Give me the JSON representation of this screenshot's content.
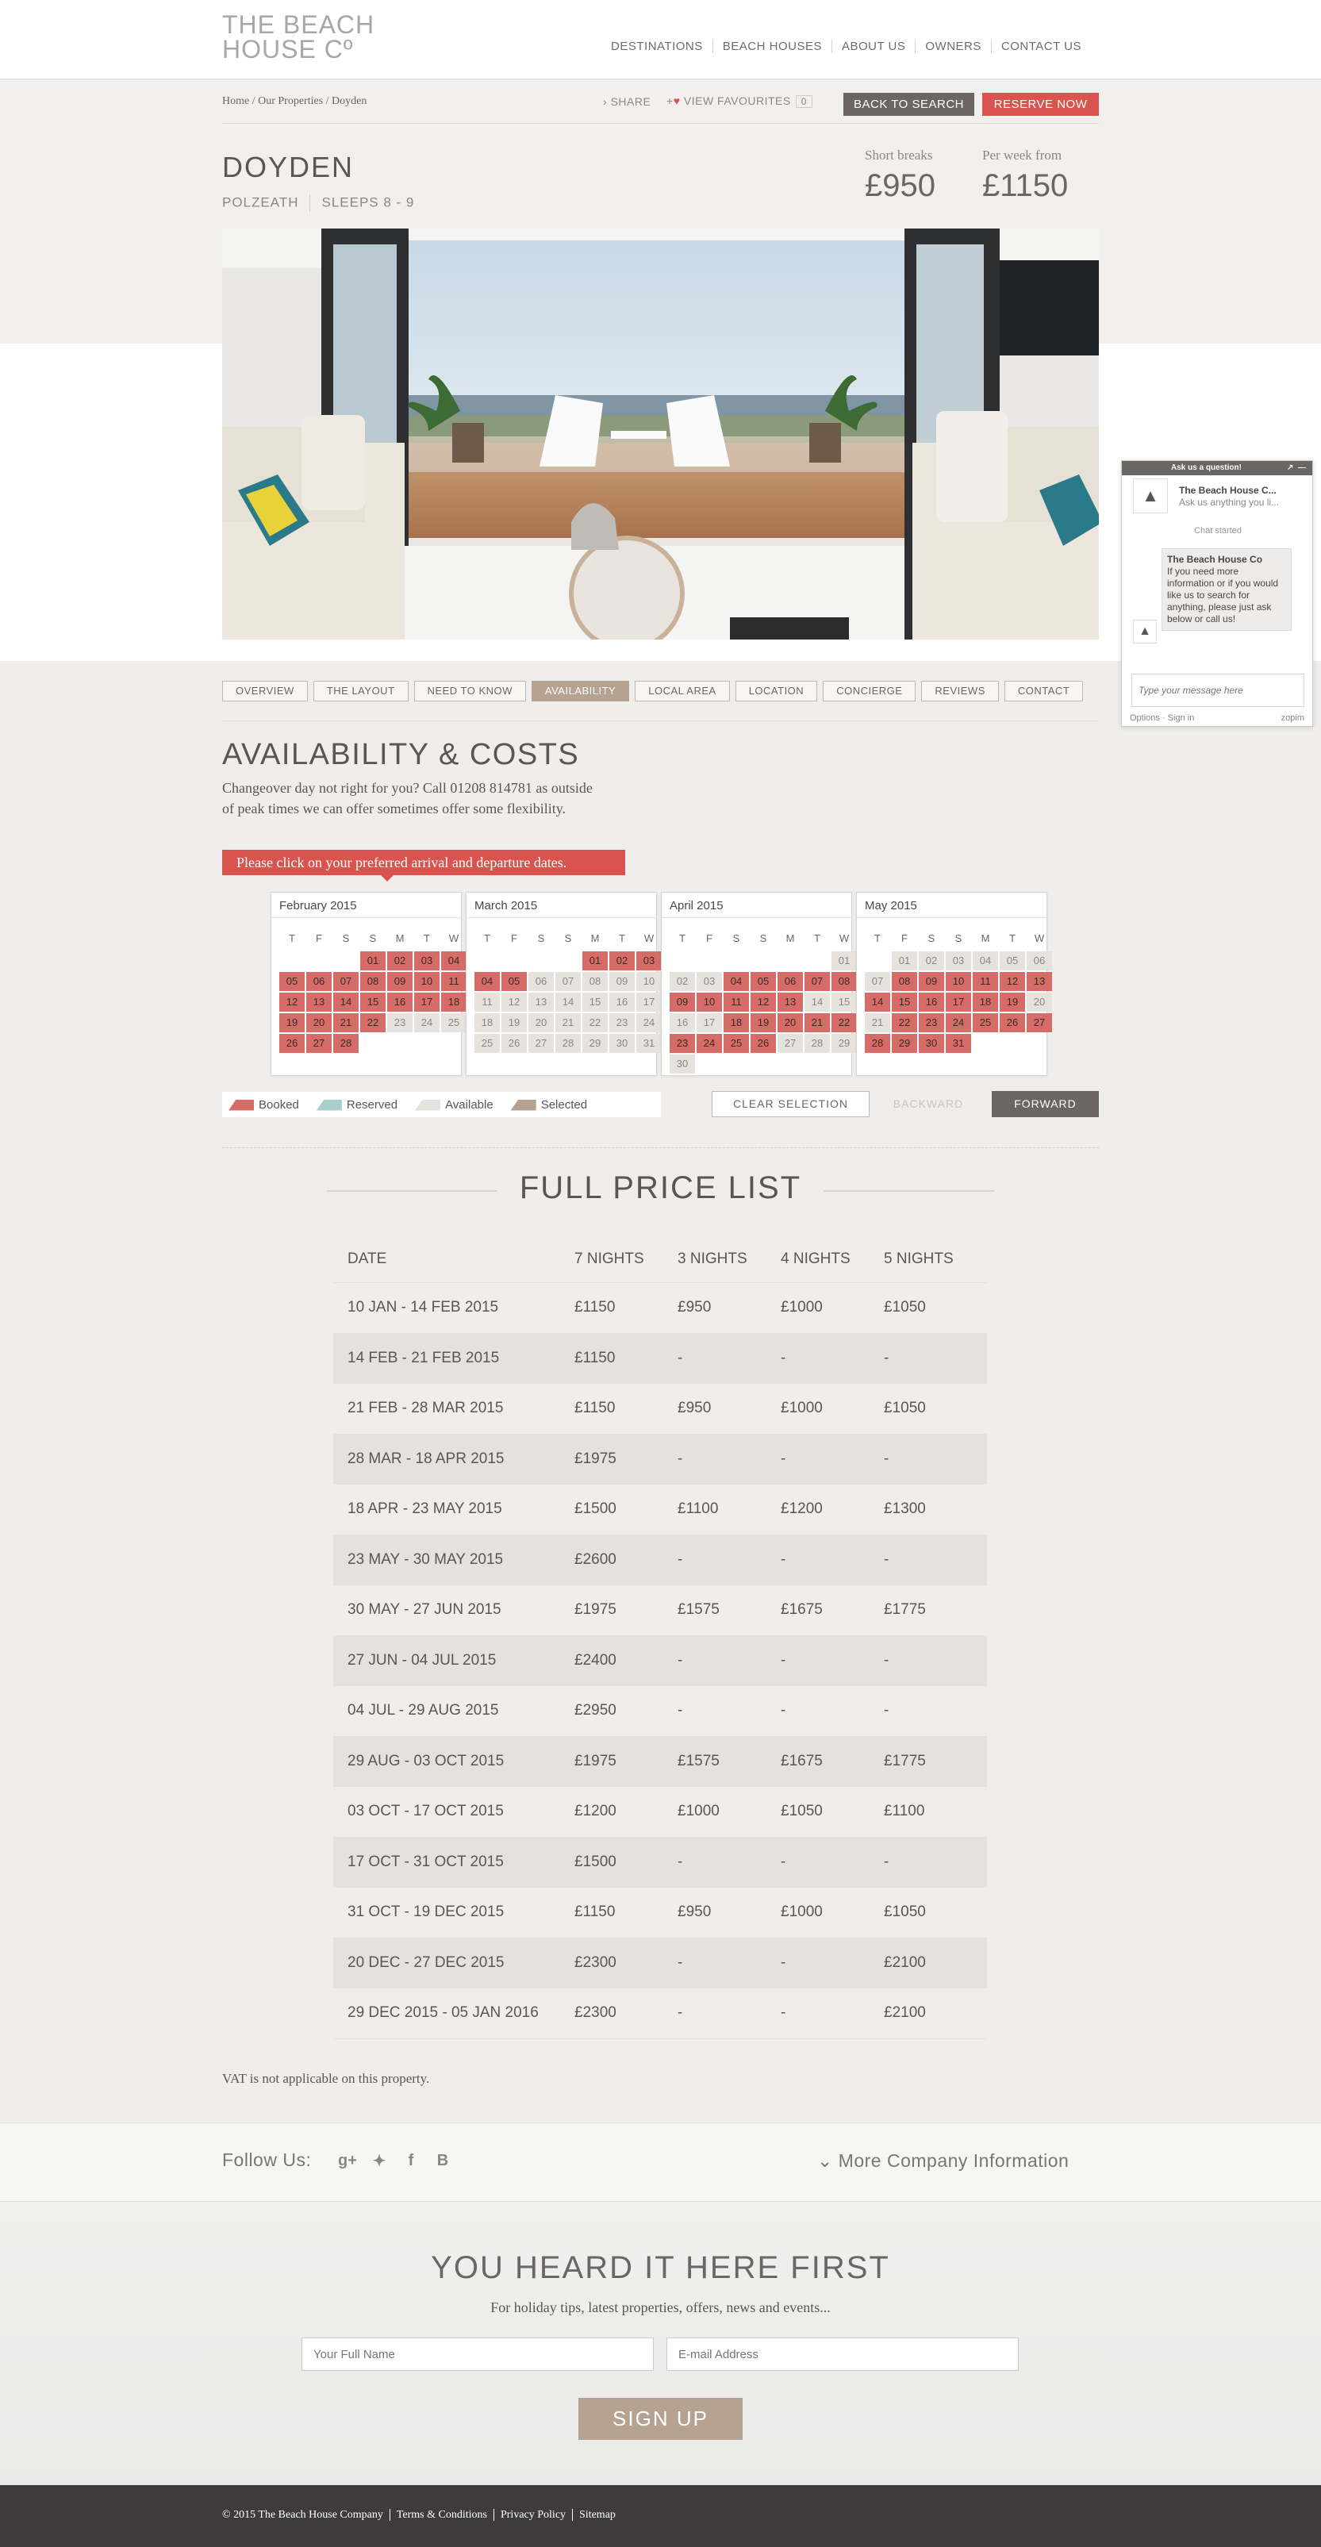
{
  "brand": {
    "logo_line1": "THE BEACH",
    "logo_line2": "HOUSE Cº"
  },
  "nav": [
    "DESTINATIONS",
    "BEACH HOUSES",
    "ABOUT US",
    "OWNERS",
    "CONTACT US"
  ],
  "breadcrumb": "Home / Our Properties / Doyden",
  "actions": {
    "share": "SHARE",
    "favourites": "VIEW FAVOURITES",
    "fav_count": "0",
    "back_to_search": "BACK TO SEARCH",
    "reserve_now": "RESERVE NOW"
  },
  "property": {
    "name": "DOYDEN",
    "location": "POLZEATH",
    "sleeps": "SLEEPS 8 - 9",
    "short_label": "Short breaks",
    "short_price": "£950",
    "week_label": "Per week from",
    "week_price": "£1150"
  },
  "tabs": [
    "OVERVIEW",
    "THE LAYOUT",
    "NEED TO KNOW",
    "AVAILABILITY",
    "LOCAL AREA",
    "LOCATION",
    "CONCIERGE",
    "REVIEWS",
    "CONTACT"
  ],
  "availability": {
    "title": "AVAILABILITY & COSTS",
    "text": "Changeover day not right for you? Call 01208 814781 as outside of peak times we can offer sometimes offer some flexibility.",
    "callout": "Please click on your preferred arrival and departure dates."
  },
  "calendar": {
    "days": [
      "T",
      "F",
      "S",
      "S",
      "M",
      "T",
      "W"
    ],
    "months": [
      {
        "name": "February 2015",
        "cells": [
          "",
          "",
          "",
          "01",
          "02",
          "03",
          "04",
          "05",
          "06",
          "07",
          "08",
          "09",
          "10",
          "11",
          "12",
          "13",
          "14",
          "15",
          "16",
          "17",
          "18",
          "19",
          "20",
          "21",
          "22",
          "23",
          "24",
          "25",
          "26",
          "27",
          "28"
        ],
        "booked": [
          3,
          4,
          5,
          6,
          7,
          8,
          9,
          10,
          11,
          12,
          13,
          14,
          15,
          16,
          17,
          18,
          19,
          20,
          21,
          22,
          23,
          24,
          28,
          29,
          30
        ],
        "avail": [
          25,
          26,
          27
        ]
      },
      {
        "name": "March 2015",
        "cells": [
          "",
          "",
          "",
          "",
          "01",
          "02",
          "03",
          "04",
          "05",
          "06",
          "07",
          "08",
          "09",
          "10",
          "11",
          "12",
          "13",
          "14",
          "15",
          "16",
          "17",
          "18",
          "19",
          "20",
          "21",
          "22",
          "23",
          "24",
          "25",
          "26",
          "27",
          "28",
          "29",
          "30",
          "31"
        ],
        "booked": [
          4,
          5,
          6,
          7,
          8
        ],
        "avail": [
          9,
          10,
          11,
          12,
          13,
          14,
          15,
          16,
          17,
          18,
          19,
          20,
          21,
          22,
          23,
          24,
          25,
          26,
          27,
          28,
          29,
          30,
          31,
          32,
          33,
          34
        ]
      },
      {
        "name": "April 2015",
        "cells": [
          "",
          "",
          "",
          "",
          "",
          "",
          "01",
          "02",
          "03",
          "04",
          "05",
          "06",
          "07",
          "08",
          "09",
          "10",
          "11",
          "12",
          "13",
          "14",
          "15",
          "16",
          "17",
          "18",
          "19",
          "20",
          "21",
          "22",
          "23",
          "24",
          "25",
          "26",
          "27",
          "28",
          "29",
          "30"
        ],
        "booked": [
          9,
          10,
          11,
          12,
          13,
          14,
          15,
          16,
          17,
          18,
          23,
          24,
          25,
          26,
          27,
          28,
          29,
          30,
          31
        ],
        "avail": [
          6,
          7,
          8,
          19,
          20,
          21,
          22,
          32,
          33,
          34,
          35
        ]
      },
      {
        "name": "May 2015",
        "cells": [
          "",
          "01",
          "02",
          "03",
          "04",
          "05",
          "06",
          "07",
          "08",
          "09",
          "10",
          "11",
          "12",
          "13",
          "14",
          "15",
          "16",
          "17",
          "18",
          "19",
          "20",
          "21",
          "22",
          "23",
          "24",
          "25",
          "26",
          "27",
          "28",
          "29",
          "30",
          "31"
        ],
        "booked": [
          8,
          9,
          10,
          11,
          12,
          13,
          14,
          15,
          16,
          17,
          18,
          19,
          22,
          23,
          24,
          25,
          26,
          27,
          28,
          29,
          30,
          31
        ],
        "avail": [
          1,
          2,
          3,
          4,
          5,
          6,
          7,
          20,
          21
        ]
      }
    ]
  },
  "legend": {
    "booked": "Booked",
    "reserved": "Reserved",
    "available": "Available",
    "selected": "Selected",
    "colors": {
      "booked": "#d56c68",
      "reserved": "#a9cfcc",
      "available": "#e6e2de",
      "selected": "#b5a291"
    }
  },
  "cal_buttons": {
    "clear": "CLEAR SELECTION",
    "backward": "BACKWARD",
    "forward": "FORWARD"
  },
  "price_list": {
    "title": "FULL PRICE LIST",
    "headers": [
      "DATE",
      "7 NIGHTS",
      "3 NIGHTS",
      "4 NIGHTS",
      "5 NIGHTS"
    ],
    "rows": [
      [
        "10 JAN - 14 FEB 2015",
        "£1150",
        "£950",
        "£1000",
        "£1050"
      ],
      [
        "14 FEB - 21 FEB 2015",
        "£1150",
        "-",
        "-",
        "-"
      ],
      [
        "21 FEB - 28 MAR 2015",
        "£1150",
        "£950",
        "£1000",
        "£1050"
      ],
      [
        "28 MAR - 18 APR 2015",
        "£1975",
        "-",
        "-",
        "-"
      ],
      [
        "18 APR - 23 MAY 2015",
        "£1500",
        "£1100",
        "£1200",
        "£1300"
      ],
      [
        "23 MAY - 30 MAY 2015",
        "£2600",
        "-",
        "-",
        "-"
      ],
      [
        "30 MAY - 27 JUN 2015",
        "£1975",
        "£1575",
        "£1675",
        "£1775"
      ],
      [
        "27 JUN - 04 JUL 2015",
        "£2400",
        "-",
        "-",
        "-"
      ],
      [
        "04 JUL - 29 AUG 2015",
        "£2950",
        "-",
        "-",
        "-"
      ],
      [
        "29 AUG - 03 OCT 2015",
        "£1975",
        "£1575",
        "£1675",
        "£1775"
      ],
      [
        "03 OCT - 17 OCT 2015",
        "£1200",
        "£1000",
        "£1050",
        "£1100"
      ],
      [
        "17 OCT - 31 OCT 2015",
        "£1500",
        "-",
        "-",
        "-"
      ],
      [
        "31 OCT - 19 DEC 2015",
        "£1150",
        "£950",
        "£1000",
        "£1050"
      ],
      [
        "20 DEC - 27 DEC 2015",
        "£2300",
        "-",
        "-",
        "£2100"
      ],
      [
        "29 DEC 2015 - 05 JAN 2016",
        "£2300",
        "-",
        "-",
        "£2100"
      ]
    ],
    "vat": "VAT is not applicable on this property."
  },
  "follow": {
    "label": "Follow Us:",
    "icons": [
      "google-plus-icon",
      "twitter-icon",
      "facebook-icon",
      "blogger-icon"
    ],
    "more": "More Company Information"
  },
  "newsletter": {
    "title": "YOU HEARD IT HERE FIRST",
    "text": "For holiday tips, latest properties, offers, news and events...",
    "name_placeholder": "Your Full Name",
    "email_placeholder": "E-mail Address",
    "button": "SIGN UP"
  },
  "footer": {
    "copyright": "© 2015 The Beach House Company",
    "links": [
      "Terms & Conditions",
      "Privacy Policy",
      "Sitemap"
    ]
  },
  "chat": {
    "header": "Ask us a question!",
    "agent": "The Beach House C...",
    "agent_sub": "Ask us anything you li...",
    "started": "Chat started",
    "msg_name": "The Beach House Co",
    "msg_text": "If you need more information or if you would like us to search for anything, please just ask below or call us!",
    "placeholder": "Type your message here",
    "options": "Options · Sign in",
    "brand": "zopim"
  }
}
